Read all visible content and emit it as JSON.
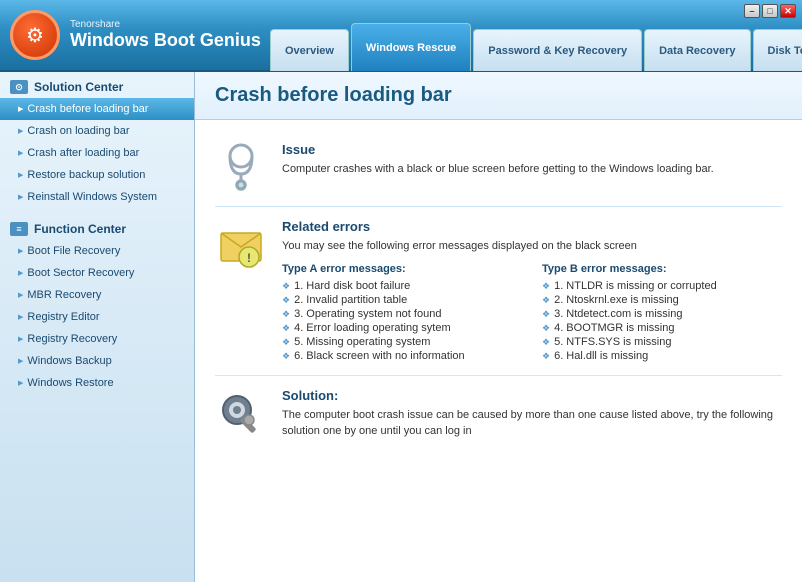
{
  "app": {
    "brand": "Tenorshare",
    "title": "Windows Boot Genius"
  },
  "window_controls": {
    "minimize": "–",
    "maximize": "□",
    "close": "✕"
  },
  "nav": {
    "tabs": [
      {
        "id": "overview",
        "label": "Overview",
        "active": false
      },
      {
        "id": "windows-rescue",
        "label": "Windows Rescue",
        "active": true
      },
      {
        "id": "password-key-recovery",
        "label": "Password & Key Recovery",
        "active": false
      },
      {
        "id": "data-recovery",
        "label": "Data Recovery",
        "active": false
      },
      {
        "id": "disk-tools",
        "label": "Disk Tools",
        "active": false
      }
    ]
  },
  "sidebar": {
    "sections": [
      {
        "id": "solution-center",
        "label": "Solution Center",
        "items": [
          {
            "id": "crash-before-loading",
            "label": "Crash before loading bar",
            "active": true
          },
          {
            "id": "crash-on-loading",
            "label": "Crash on loading bar",
            "active": false
          },
          {
            "id": "crash-after-loading",
            "label": "Crash after loading bar",
            "active": false
          },
          {
            "id": "restore-backup",
            "label": "Restore backup solution",
            "active": false
          },
          {
            "id": "reinstall-windows",
            "label": "Reinstall Windows System",
            "active": false
          }
        ]
      },
      {
        "id": "function-center",
        "label": "Function Center",
        "items": [
          {
            "id": "boot-file-recovery",
            "label": "Boot File Recovery",
            "active": false
          },
          {
            "id": "boot-sector-recovery",
            "label": "Boot Sector Recovery",
            "active": false
          },
          {
            "id": "mbr-recovery",
            "label": "MBR Recovery",
            "active": false
          },
          {
            "id": "registry-editor",
            "label": "Registry Editor",
            "active": false
          },
          {
            "id": "registry-recovery",
            "label": "Registry Recovery",
            "active": false
          },
          {
            "id": "windows-backup",
            "label": "Windows Backup",
            "active": false
          },
          {
            "id": "windows-restore",
            "label": "Windows Restore",
            "active": false
          }
        ]
      }
    ]
  },
  "content": {
    "page_title": "Crash before loading bar",
    "sections": [
      {
        "id": "issue",
        "title": "Issue",
        "description": "Computer crashes with a black or blue screen before getting to the Windows loading bar."
      },
      {
        "id": "related-errors",
        "title": "Related errors",
        "description": "You may see the following error messages displayed on the black screen",
        "type_a_header": "Type A error messages:",
        "type_b_header": "Type B error messages:",
        "type_a_errors": [
          "1. Hard disk boot failure",
          "2. Invalid partition table",
          "3. Operating system not found",
          "4. Error loading operating sytem",
          "5. Missing operating system",
          "6. Black screen with no information"
        ],
        "type_b_errors": [
          "1. NTLDR is missing or corrupted",
          "2. Ntoskrnl.exe is missing",
          "3. Ntdetect.com is missing",
          "4. BOOTMGR is missing",
          "5. NTFS.SYS is missing",
          "6. Hal.dll is missing"
        ]
      },
      {
        "id": "solution",
        "title": "Solution:",
        "description": "The computer boot crash issue can be caused by more than one cause listed above, try the following solution one by one until you can log in"
      }
    ]
  }
}
